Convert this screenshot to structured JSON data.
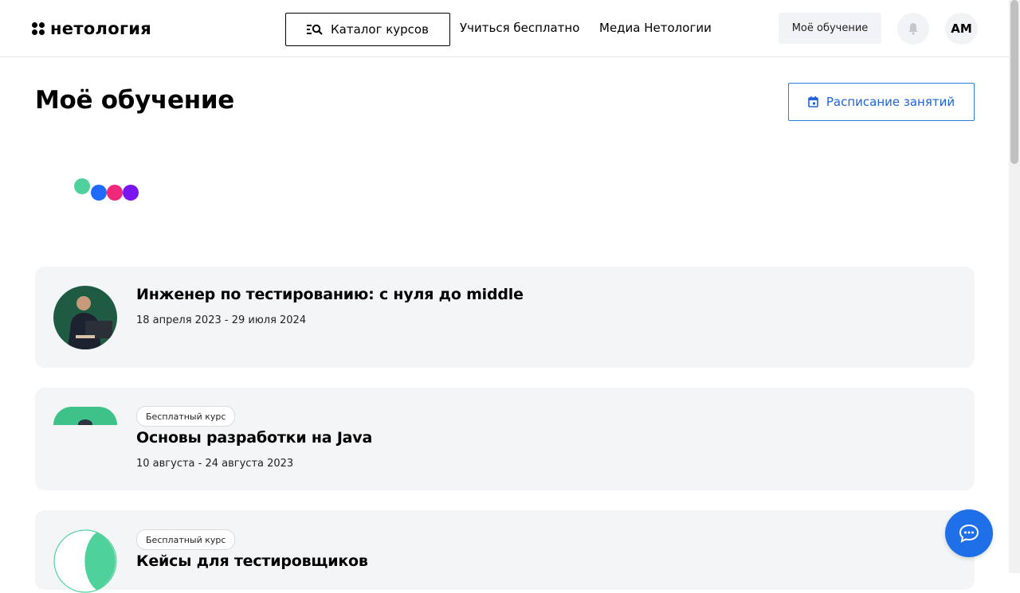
{
  "header": {
    "logo_text": "нетология",
    "catalog_label": "Каталог курсов",
    "nav": [
      {
        "label": "Учиться бесплатно"
      },
      {
        "label": "Медиа Нетологии"
      }
    ],
    "my_learning_label": "Моё обучение",
    "avatar_initials": "АМ"
  },
  "page": {
    "title": "Моё обучение",
    "schedule_label": "Расписание занятий"
  },
  "colors": {
    "accent_blue": "#1e6fe8",
    "dot_green": "#4fd19c",
    "dot_blue": "#1f6bff",
    "dot_pink": "#f0287a",
    "dot_purple": "#7b15f0"
  },
  "courses": [
    {
      "badge": "",
      "title": "Инженер по тестированию: с нуля до middle",
      "dates": "18 апреля 2023 - 29 июля 2024"
    },
    {
      "badge": "Бесплатный курс",
      "title": "Основы разработки на Java",
      "dates": "10 августа - 24 августа 2023"
    },
    {
      "badge": "Бесплатный курс",
      "title": "Кейсы для тестировщиков",
      "dates": ""
    }
  ],
  "icons": {
    "catalog": "list-search-icon",
    "schedule": "calendar-icon",
    "bell": "bell-icon",
    "chat": "chat-bubble-icon"
  }
}
